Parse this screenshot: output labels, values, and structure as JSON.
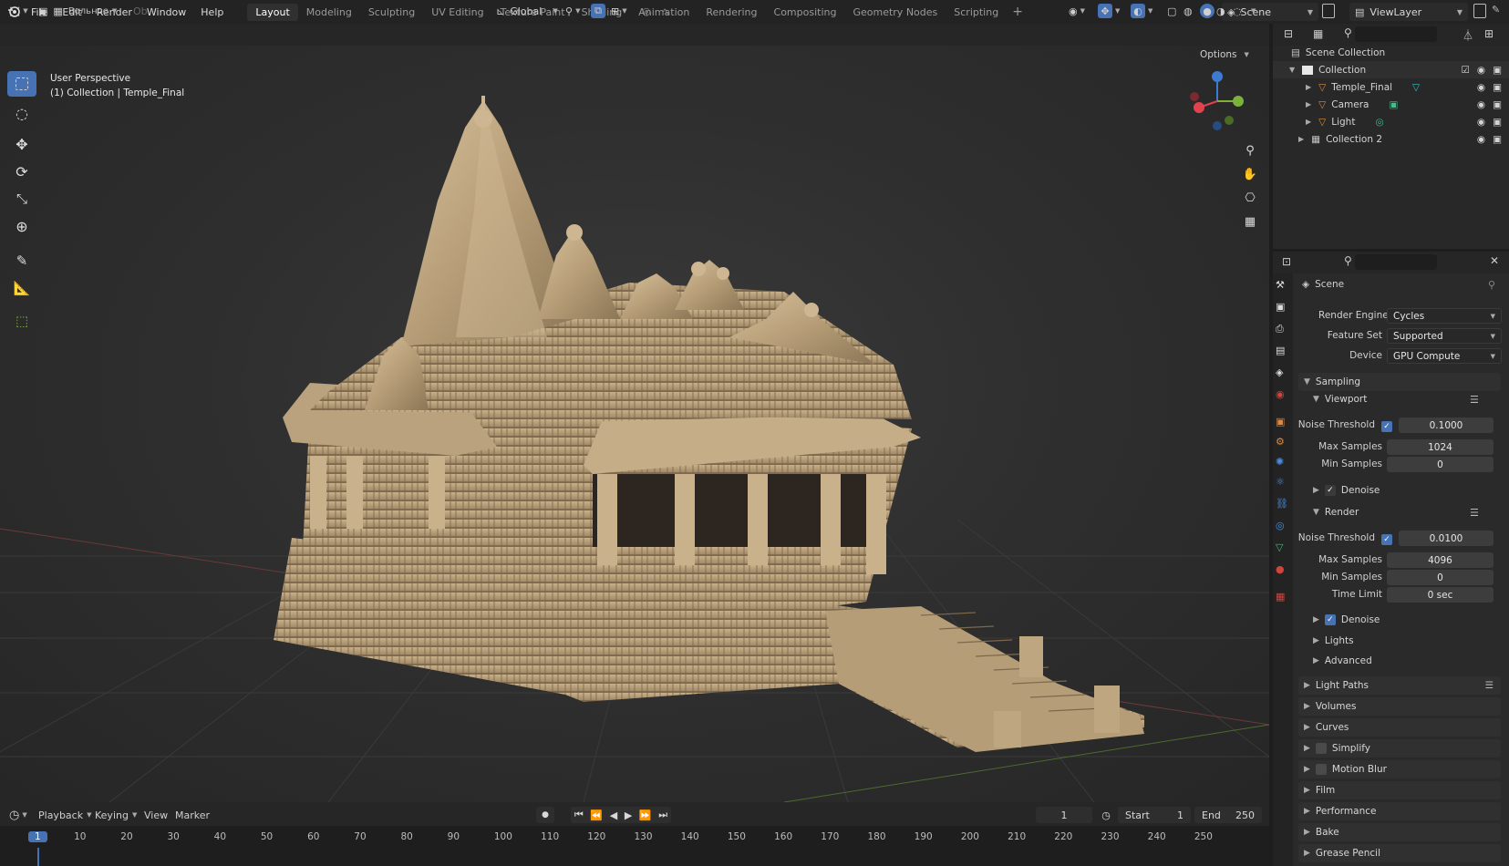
{
  "menu": {
    "items": [
      "File",
      "Edit",
      "Render",
      "Window",
      "Help"
    ],
    "workspaces": [
      "Layout",
      "Modeling",
      "Sculpting",
      "UV Editing",
      "Texture Paint",
      "Shading",
      "Animation",
      "Rendering",
      "Compositing",
      "Geometry Nodes",
      "Scripting"
    ],
    "active_workspace": "Layout",
    "scene": "Scene",
    "view_layer": "ViewLayer"
  },
  "viewport_header": {
    "mode_label": "Вольное",
    "extra_label": "Ob",
    "transform_orientation": "Global",
    "options_label": "Options"
  },
  "viewport": {
    "perspective": "User Perspective",
    "collection_info": "(1) Collection | Temple_Final"
  },
  "outliner": {
    "root": "Scene Collection",
    "items": [
      {
        "label": "Collection"
      },
      {
        "label": "Temple_Final"
      },
      {
        "label": "Camera"
      },
      {
        "label": "Light"
      },
      {
        "label": "Collection 2"
      }
    ]
  },
  "properties": {
    "context": "Scene",
    "render_engine_label": "Render Engine",
    "render_engine": "Cycles",
    "feature_set_label": "Feature Set",
    "feature_set": "Supported",
    "device_label": "Device",
    "device": "GPU Compute",
    "sampling": "Sampling",
    "viewport": {
      "title": "Viewport",
      "noise_threshold_label": "Noise Threshold",
      "noise_threshold": "0.1000",
      "max_samples_label": "Max Samples",
      "max_samples": "1024",
      "min_samples_label": "Min Samples",
      "min_samples": "0",
      "denoise": "Denoise"
    },
    "render": {
      "title": "Render",
      "noise_threshold_label": "Noise Threshold",
      "noise_threshold": "0.0100",
      "max_samples_label": "Max Samples",
      "max_samples": "4096",
      "min_samples_label": "Min Samples",
      "min_samples": "0",
      "time_limit_label": "Time Limit",
      "time_limit": "0 sec",
      "denoise": "Denoise"
    },
    "lights": "Lights",
    "advanced": "Advanced",
    "sections": [
      "Light Paths",
      "Volumes",
      "Curves",
      "Simplify",
      "Motion Blur",
      "Film",
      "Performance",
      "Bake",
      "Grease Pencil"
    ]
  },
  "timeline": {
    "menu": [
      "Playback",
      "Keying",
      "View",
      "Marker"
    ],
    "current_frame": "1",
    "start_label": "Start",
    "start": "1",
    "end_label": "End",
    "end": "250",
    "ticks": [
      "1",
      "10",
      "20",
      "30",
      "40",
      "50",
      "60",
      "70",
      "80",
      "90",
      "100",
      "110",
      "120",
      "130",
      "140",
      "150",
      "160",
      "170",
      "180",
      "190",
      "200",
      "210",
      "220",
      "230",
      "240",
      "250"
    ]
  },
  "colors": {
    "accent": "#4772b3",
    "stone": "#c9b08a",
    "axis_x": "#e0424e",
    "axis_y": "#7ab23a",
    "axis_z": "#3d7bd1"
  }
}
